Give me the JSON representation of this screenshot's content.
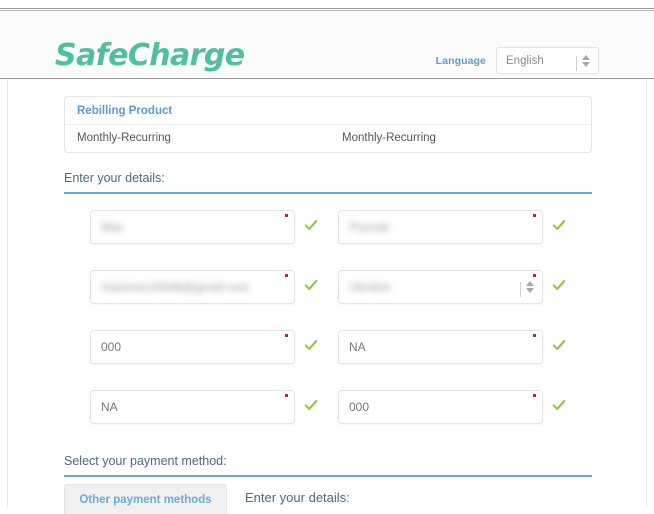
{
  "header": {
    "logo_text": "SafeCharge",
    "logo_color": "#4ec0a0",
    "language_label": "Language",
    "language_value": "English"
  },
  "rebilling": {
    "title": "Rebilling Product",
    "row": {
      "col1": "Monthly-Recurring",
      "col2": "Monthly-Recurring"
    }
  },
  "sections": {
    "details_heading": "Enter your details:",
    "payment_heading": "Select your payment method:"
  },
  "form": {
    "rows": [
      {
        "left": {
          "value": "Max",
          "redacted": true,
          "required": true,
          "valid": true,
          "type": "text"
        },
        "right": {
          "value": "Prymak",
          "redacted": true,
          "required": true,
          "valid": true,
          "type": "text"
        }
      },
      {
        "left": {
          "value": "maximov19596@gmail.com",
          "redacted": true,
          "required": true,
          "valid": true,
          "type": "email"
        },
        "right": {
          "value": "Ukraine",
          "redacted": true,
          "required": true,
          "valid": true,
          "type": "select"
        }
      },
      {
        "left": {
          "value": "000",
          "redacted": false,
          "required": true,
          "valid": true,
          "type": "text"
        },
        "right": {
          "value": "NA",
          "redacted": false,
          "required": true,
          "valid": true,
          "type": "text"
        }
      },
      {
        "left": {
          "value": "NA",
          "redacted": false,
          "required": true,
          "valid": true,
          "type": "text"
        },
        "right": {
          "value": "000",
          "redacted": false,
          "required": true,
          "valid": true,
          "type": "text"
        }
      }
    ]
  },
  "payment": {
    "tab_label": "Other payment methods",
    "detail_heading": "Enter your details:"
  },
  "colors": {
    "brand_teal": "#4ec0a0",
    "accent_blue": "#5b9bd5",
    "rule_blue": "#63a8d8",
    "check_green": "#8cc63e",
    "required_red": "#b03030"
  }
}
